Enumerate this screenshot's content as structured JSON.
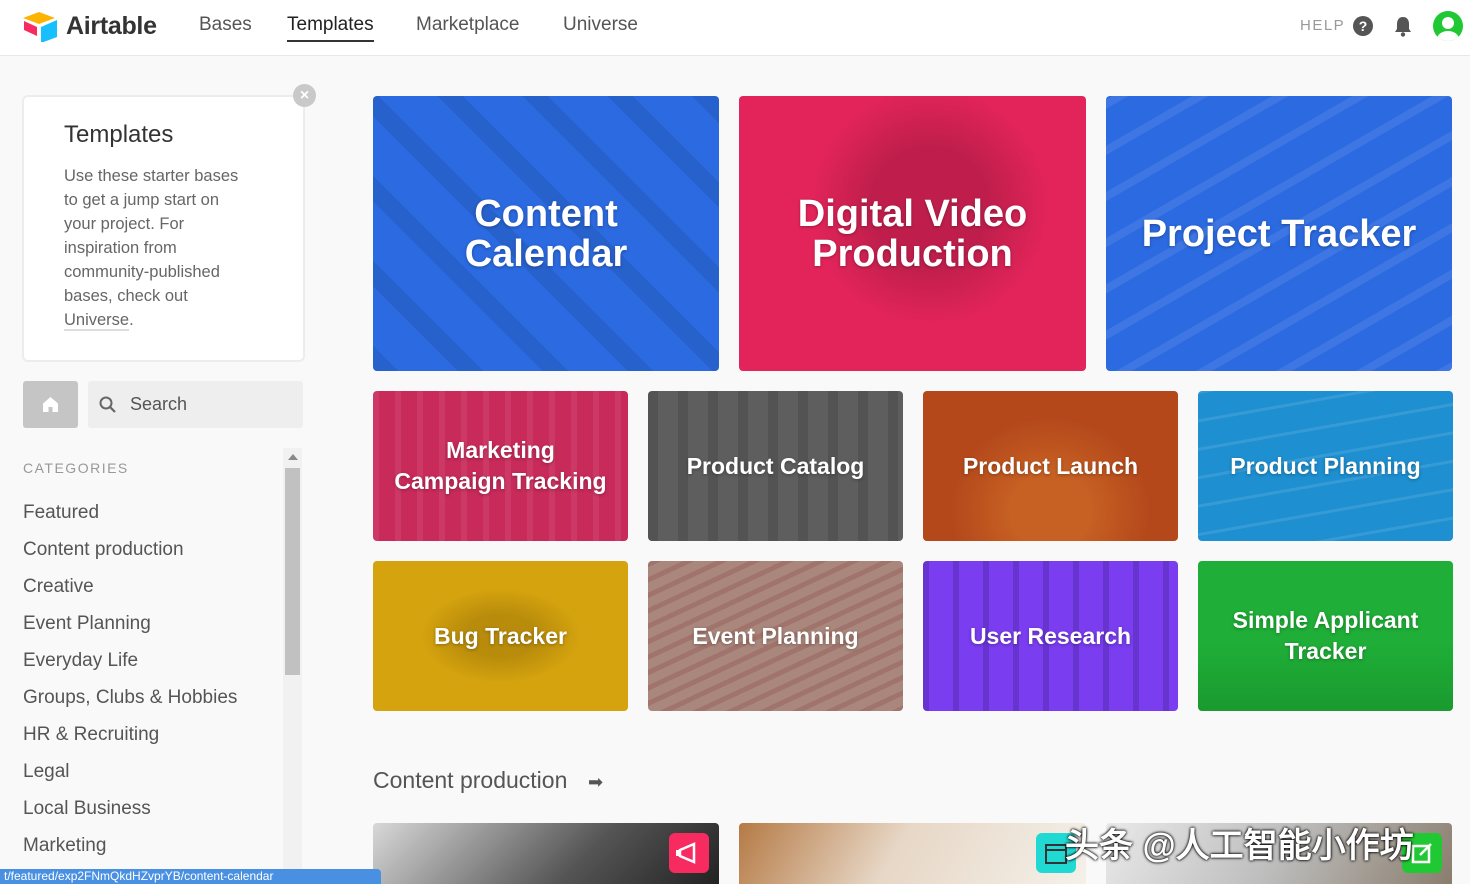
{
  "app": {
    "brand": "Airtable"
  },
  "nav": {
    "links": [
      {
        "label": "Bases"
      },
      {
        "label": "Templates"
      },
      {
        "label": "Marketplace"
      },
      {
        "label": "Universe"
      }
    ],
    "help_label": "HELP",
    "help_icon": "?"
  },
  "intro": {
    "title": "Templates",
    "text": "Use these starter bases to get a jump start on your project. For inspiration from community-published bases, check out ",
    "link": "Universe",
    "link_suffix": ".",
    "close": "×"
  },
  "search": {
    "placeholder": "Search"
  },
  "categories": {
    "header": "CATEGORIES",
    "items": [
      "Featured",
      "Content production",
      "Creative",
      "Event Planning",
      "Everyday Life",
      "Groups, Clubs & Hobbies",
      "HR & Recruiting",
      "Legal",
      "Local Business",
      "Marketing"
    ]
  },
  "featured": [
    {
      "label": "Content\nCalendar",
      "color": "#2b6ae0"
    },
    {
      "label": "Digital Video\nProduction",
      "color": "#e3245a"
    },
    {
      "label": "Project Tracker",
      "color": "#2b6ae0"
    },
    {
      "label": "Marketing\nCampaign Tracking",
      "color": "#c82a5a"
    },
    {
      "label": "Product Catalog",
      "color": "#5e5e5e"
    },
    {
      "label": "Product Launch",
      "color": "#b4481b"
    },
    {
      "label": "Product Planning",
      "color": "#1e8fd0"
    },
    {
      "label": "Bug Tracker",
      "color": "#d5a30e"
    },
    {
      "label": "Event Planning",
      "color": "#a9877c"
    },
    {
      "label": "User Research",
      "color": "#7a3df0"
    },
    {
      "label": "Simple Applicant\nTracker",
      "color": "#1fae37"
    }
  ],
  "section": {
    "title": "Content production",
    "arrow": "➡"
  },
  "status_url": "t/featured/exp2FNmQkdHZvprYB/content-calendar",
  "watermark": "头条 @人工智能小作坊"
}
